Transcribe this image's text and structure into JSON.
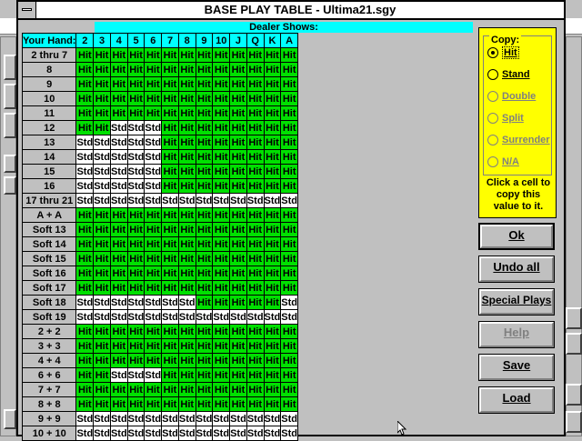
{
  "window": {
    "title": "BASE PLAY TABLE - Ultima21.sgy"
  },
  "grid": {
    "dealer_header": "Dealer Shows:",
    "corner_label": "Your Hand:",
    "columns": [
      "2",
      "3",
      "4",
      "5",
      "6",
      "7",
      "8",
      "9",
      "10",
      "J",
      "Q",
      "K",
      "A"
    ],
    "rows": [
      {
        "label": "2 thru 7",
        "cells": [
          "Hit",
          "Hit",
          "Hit",
          "Hit",
          "Hit",
          "Hit",
          "Hit",
          "Hit",
          "Hit",
          "Hit",
          "Hit",
          "Hit",
          "Hit"
        ]
      },
      {
        "label": "8",
        "cells": [
          "Hit",
          "Hit",
          "Hit",
          "Hit",
          "Hit",
          "Hit",
          "Hit",
          "Hit",
          "Hit",
          "Hit",
          "Hit",
          "Hit",
          "Hit"
        ]
      },
      {
        "label": "9",
        "cells": [
          "Hit",
          "Hit",
          "Hit",
          "Hit",
          "Hit",
          "Hit",
          "Hit",
          "Hit",
          "Hit",
          "Hit",
          "Hit",
          "Hit",
          "Hit"
        ]
      },
      {
        "label": "10",
        "cells": [
          "Hit",
          "Hit",
          "Hit",
          "Hit",
          "Hit",
          "Hit",
          "Hit",
          "Hit",
          "Hit",
          "Hit",
          "Hit",
          "Hit",
          "Hit"
        ]
      },
      {
        "label": "11",
        "cells": [
          "Hit",
          "Hit",
          "Hit",
          "Hit",
          "Hit",
          "Hit",
          "Hit",
          "Hit",
          "Hit",
          "Hit",
          "Hit",
          "Hit",
          "Hit"
        ]
      },
      {
        "label": "12",
        "cells": [
          "Hit",
          "Hit",
          "Std",
          "Std",
          "Std",
          "Hit",
          "Hit",
          "Hit",
          "Hit",
          "Hit",
          "Hit",
          "Hit",
          "Hit"
        ]
      },
      {
        "label": "13",
        "cells": [
          "Std",
          "Std",
          "Std",
          "Std",
          "Std",
          "Hit",
          "Hit",
          "Hit",
          "Hit",
          "Hit",
          "Hit",
          "Hit",
          "Hit"
        ]
      },
      {
        "label": "14",
        "cells": [
          "Std",
          "Std",
          "Std",
          "Std",
          "Std",
          "Hit",
          "Hit",
          "Hit",
          "Hit",
          "Hit",
          "Hit",
          "Hit",
          "Hit"
        ]
      },
      {
        "label": "15",
        "cells": [
          "Std",
          "Std",
          "Std",
          "Std",
          "Std",
          "Hit",
          "Hit",
          "Hit",
          "Hit",
          "Hit",
          "Hit",
          "Hit",
          "Hit"
        ]
      },
      {
        "label": "16",
        "cells": [
          "Std",
          "Std",
          "Std",
          "Std",
          "Std",
          "Hit",
          "Hit",
          "Hit",
          "Hit",
          "Hit",
          "Hit",
          "Hit",
          "Hit"
        ]
      },
      {
        "label": "17 thru 21",
        "cells": [
          "Std",
          "Std",
          "Std",
          "Std",
          "Std",
          "Std",
          "Std",
          "Std",
          "Std",
          "Std",
          "Std",
          "Std",
          "Std"
        ]
      },
      {
        "label": "A + A",
        "cells": [
          "Hit",
          "Hit",
          "Hit",
          "Hit",
          "Hit",
          "Hit",
          "Hit",
          "Hit",
          "Hit",
          "Hit",
          "Hit",
          "Hit",
          "Hit"
        ]
      },
      {
        "label": "Soft 13",
        "cells": [
          "Hit",
          "Hit",
          "Hit",
          "Hit",
          "Hit",
          "Hit",
          "Hit",
          "Hit",
          "Hit",
          "Hit",
          "Hit",
          "Hit",
          "Hit"
        ]
      },
      {
        "label": "Soft 14",
        "cells": [
          "Hit",
          "Hit",
          "Hit",
          "Hit",
          "Hit",
          "Hit",
          "Hit",
          "Hit",
          "Hit",
          "Hit",
          "Hit",
          "Hit",
          "Hit"
        ]
      },
      {
        "label": "Soft 15",
        "cells": [
          "Hit",
          "Hit",
          "Hit",
          "Hit",
          "Hit",
          "Hit",
          "Hit",
          "Hit",
          "Hit",
          "Hit",
          "Hit",
          "Hit",
          "Hit"
        ]
      },
      {
        "label": "Soft 16",
        "cells": [
          "Hit",
          "Hit",
          "Hit",
          "Hit",
          "Hit",
          "Hit",
          "Hit",
          "Hit",
          "Hit",
          "Hit",
          "Hit",
          "Hit",
          "Hit"
        ]
      },
      {
        "label": "Soft 17",
        "cells": [
          "Hit",
          "Hit",
          "Hit",
          "Hit",
          "Hit",
          "Hit",
          "Hit",
          "Hit",
          "Hit",
          "Hit",
          "Hit",
          "Hit",
          "Hit"
        ]
      },
      {
        "label": "Soft 18",
        "cells": [
          "Std",
          "Std",
          "Std",
          "Std",
          "Std",
          "Std",
          "Std",
          "Hit",
          "Hit",
          "Hit",
          "Hit",
          "Hit",
          "Std"
        ]
      },
      {
        "label": "Soft 19",
        "cells": [
          "Std",
          "Std",
          "Std",
          "Std",
          "Std",
          "Std",
          "Std",
          "Std",
          "Std",
          "Std",
          "Std",
          "Std",
          "Std"
        ]
      },
      {
        "label": "2 + 2",
        "cells": [
          "Hit",
          "Hit",
          "Hit",
          "Hit",
          "Hit",
          "Hit",
          "Hit",
          "Hit",
          "Hit",
          "Hit",
          "Hit",
          "Hit",
          "Hit"
        ]
      },
      {
        "label": "3 + 3",
        "cells": [
          "Hit",
          "Hit",
          "Hit",
          "Hit",
          "Hit",
          "Hit",
          "Hit",
          "Hit",
          "Hit",
          "Hit",
          "Hit",
          "Hit",
          "Hit"
        ]
      },
      {
        "label": "4 + 4",
        "cells": [
          "Hit",
          "Hit",
          "Hit",
          "Hit",
          "Hit",
          "Hit",
          "Hit",
          "Hit",
          "Hit",
          "Hit",
          "Hit",
          "Hit",
          "Hit"
        ]
      },
      {
        "label": "6 + 6",
        "cells": [
          "Hit",
          "Hit",
          "Std",
          "Std",
          "Std",
          "Hit",
          "Hit",
          "Hit",
          "Hit",
          "Hit",
          "Hit",
          "Hit",
          "Hit"
        ]
      },
      {
        "label": "7 + 7",
        "cells": [
          "Hit",
          "Hit",
          "Hit",
          "Hit",
          "Hit",
          "Hit",
          "Hit",
          "Hit",
          "Hit",
          "Hit",
          "Hit",
          "Hit",
          "Hit"
        ]
      },
      {
        "label": "8 + 8",
        "cells": [
          "Hit",
          "Hit",
          "Hit",
          "Hit",
          "Hit",
          "Hit",
          "Hit",
          "Hit",
          "Hit",
          "Hit",
          "Hit",
          "Hit",
          "Hit"
        ]
      },
      {
        "label": "9 + 9",
        "cells": [
          "Std",
          "Std",
          "Std",
          "Std",
          "Std",
          "Std",
          "Std",
          "Std",
          "Std",
          "Std",
          "Std",
          "Std",
          "Std"
        ]
      },
      {
        "label": "10 + 10",
        "cells": [
          "Std",
          "Std",
          "Std",
          "Std",
          "Std",
          "Std",
          "Std",
          "Std",
          "Std",
          "Std",
          "Std",
          "Std",
          "Std"
        ]
      }
    ]
  },
  "copy_panel": {
    "title": "Copy:",
    "options": [
      {
        "label": "Hit",
        "selected": true,
        "enabled": true
      },
      {
        "label": "Stand",
        "selected": false,
        "enabled": true
      },
      {
        "label": "Double",
        "selected": false,
        "enabled": false
      },
      {
        "label": "Split",
        "selected": false,
        "enabled": false
      },
      {
        "label": "Surrender",
        "selected": false,
        "enabled": false
      },
      {
        "label": "N/A",
        "selected": false,
        "enabled": false
      }
    ],
    "hint": "Click a cell to copy this value to it."
  },
  "buttons": {
    "ok": "Ok",
    "undo_all": "Undo all",
    "special_plays": "Special Plays",
    "help": "Help",
    "save": "Save",
    "load": "Load"
  },
  "colors": {
    "hit": "#00e000",
    "stand": "#ffffff",
    "header": "#00ffff",
    "copy_panel": "#ffff00"
  }
}
